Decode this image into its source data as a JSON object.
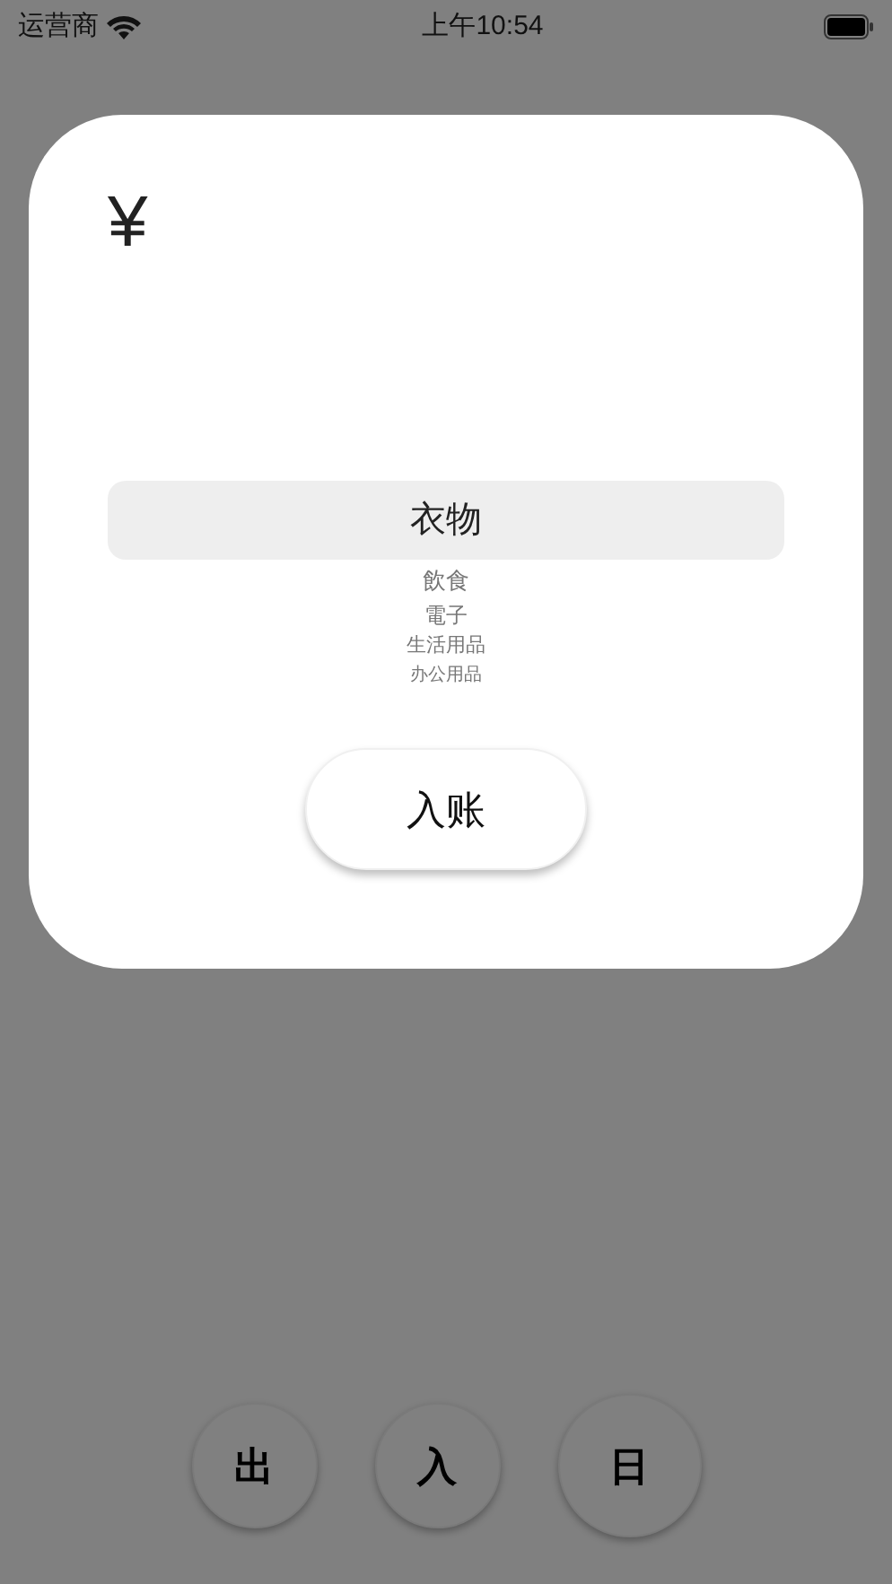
{
  "status_bar": {
    "carrier": "运营商",
    "time": "上午10:54"
  },
  "dialog": {
    "currency_symbol": "¥",
    "picker": {
      "items": [
        {
          "label": "衣物",
          "selected": true
        },
        {
          "label": "飲食",
          "selected": false
        },
        {
          "label": "電子",
          "selected": false
        },
        {
          "label": "生活用品",
          "selected": false
        },
        {
          "label": "办公用品",
          "selected": false
        }
      ]
    },
    "confirm_button": "入账"
  },
  "bottom_buttons": [
    {
      "label": "出"
    },
    {
      "label": "入"
    },
    {
      "label": "日"
    }
  ]
}
